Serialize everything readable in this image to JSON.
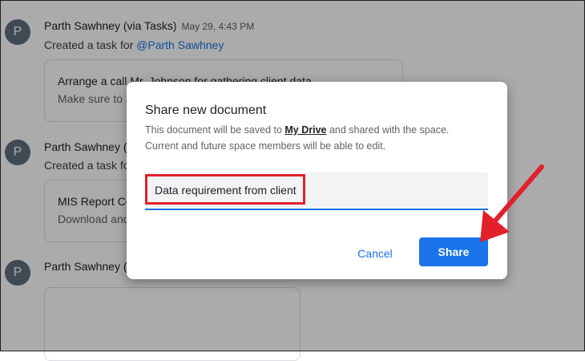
{
  "chat": {
    "messages": [
      {
        "avatar": "P",
        "sender": "Parth Sawhney (via Tasks)",
        "timestamp": "May 29, 4:43 PM",
        "text_prefix": "Created a task for ",
        "mention": "@Parth Sawhney",
        "card_title": "Arrange a call Mr. Johnson for gathering client data",
        "card_sub": "Make sure to a"
      },
      {
        "avatar": "P",
        "sender": "Parth Sawhney (",
        "text_prefix": "Created a task fo",
        "card_title": "MIS Report Co",
        "card_sub": "Download and"
      },
      {
        "avatar": "P",
        "sender": "Parth Sawhney ("
      }
    ]
  },
  "dialog": {
    "title": "Share new document",
    "desc_prefix": "This document will be saved to ",
    "drive_link": "My Drive",
    "desc_suffix": " and shared with the space.",
    "desc_line2": "Current and future space members will be able to edit.",
    "input_value": "Data requirement from client",
    "cancel_label": "Cancel",
    "share_label": "Share"
  },
  "colors": {
    "accent": "#1a73e8",
    "annotation": "#e2202a",
    "avatar": "#5f6f7f"
  }
}
